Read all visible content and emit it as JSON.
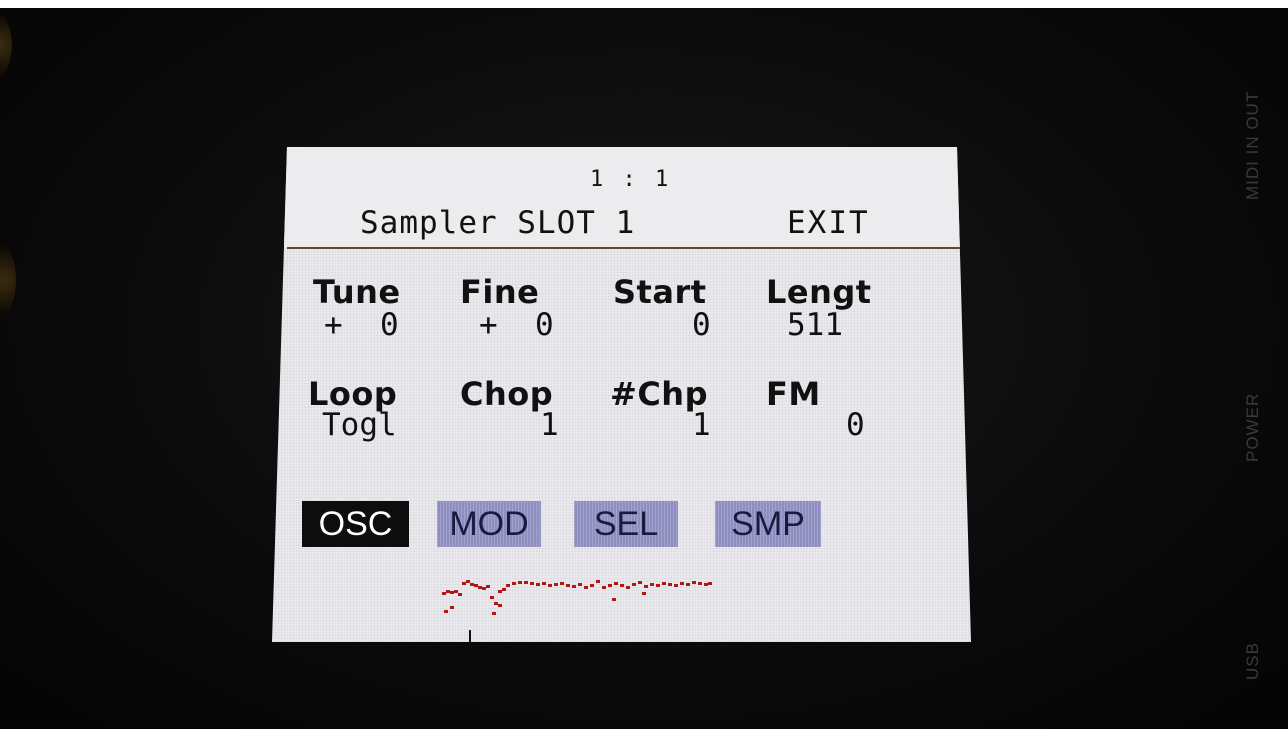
{
  "screen": {
    "position_readout": "1 :  1",
    "title": "Sampler SLOT 1",
    "exit_label": "EXIT",
    "params": [
      {
        "label": "Tune",
        "value": "+  0"
      },
      {
        "label": "Fine",
        "value": "+  0"
      },
      {
        "label": "Start",
        "value": "0"
      },
      {
        "label": "Lengt",
        "value": "511"
      },
      {
        "label": "Loop",
        "value": "Togl"
      },
      {
        "label": "Chop",
        "value": "1"
      },
      {
        "label": "#Chp",
        "value": "1"
      },
      {
        "label": "FM",
        "value": "0"
      }
    ],
    "tabs": [
      {
        "label": "OSC",
        "active": true
      },
      {
        "label": "MOD",
        "active": false
      },
      {
        "label": "SEL",
        "active": false
      },
      {
        "label": "SMP",
        "active": false
      }
    ],
    "waveform_color": "#b01818"
  },
  "device_labels": {
    "midi": "MIDI IN  OUT",
    "power": "POWER",
    "usb": "USB"
  }
}
